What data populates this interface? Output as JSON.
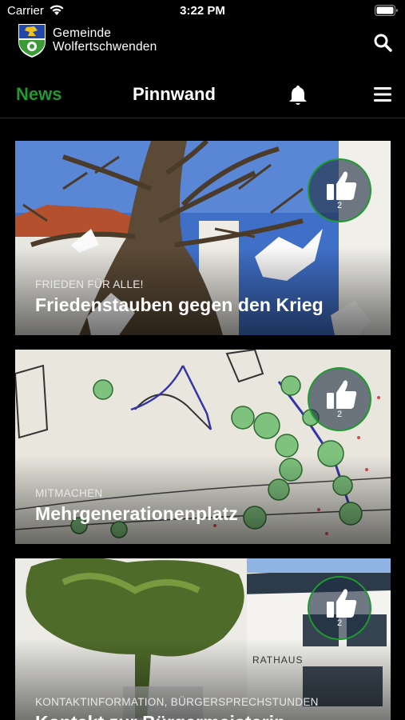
{
  "status": {
    "carrier": "Carrier",
    "time": "3:22 PM"
  },
  "header": {
    "brand_line1": "Gemeinde",
    "brand_line2": "Wolfertschwenden"
  },
  "tabs": {
    "news": "News",
    "pinnwand": "Pinnwand"
  },
  "colors": {
    "accent": "#1f9a2e",
    "background": "#000000"
  },
  "icons": [
    "wifi-icon",
    "battery-icon",
    "coat-of-arms-logo",
    "search-icon",
    "bell-icon",
    "menu-icon",
    "thumbs-up-icon"
  ],
  "cards": [
    {
      "category": "FRIEDEN FÜR ALLE!",
      "title": "Friedenstauben gegen den Krieg",
      "likes": "2"
    },
    {
      "category": "MITMACHEN",
      "title": "Mehrgenerationenplatz",
      "likes": "2"
    },
    {
      "category": "KONTAKTINFORMATION, BÜRGERSPRECHSTUNDEN",
      "title": "Kontakt zur Bürgermeisterin",
      "likes": "2",
      "sign_text": "RATHAUS"
    }
  ]
}
